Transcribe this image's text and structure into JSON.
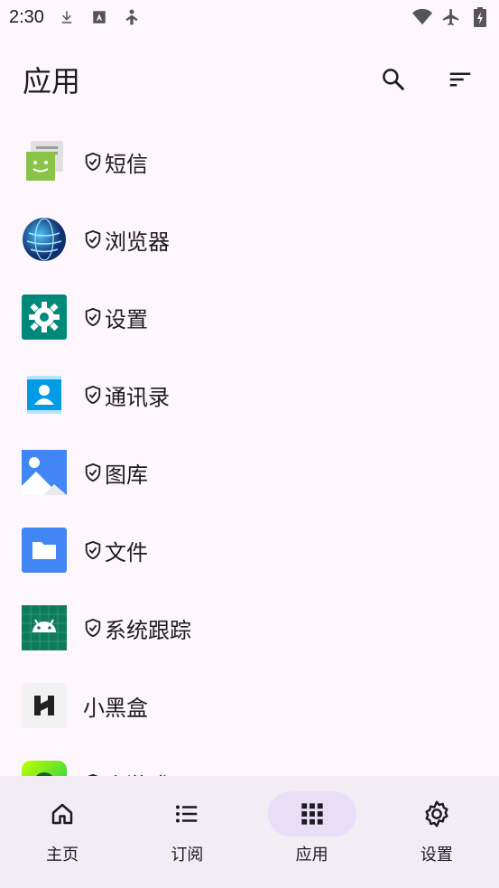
{
  "status_bar": {
    "time": "2:30",
    "left_icons": [
      "download-icon",
      "font-a-icon",
      "accessibility-icon"
    ],
    "right_icons": [
      "wifi-icon",
      "airplane-icon",
      "battery-charging-icon"
    ]
  },
  "header": {
    "title": "应用",
    "actions": [
      "search-icon",
      "sort-icon"
    ]
  },
  "apps": [
    {
      "label": "短信",
      "protected": true,
      "icon": "messages-icon"
    },
    {
      "label": "浏览器",
      "protected": true,
      "icon": "browser-icon"
    },
    {
      "label": "设置",
      "protected": true,
      "icon": "settings-app-icon"
    },
    {
      "label": "通讯录",
      "protected": true,
      "icon": "contacts-icon"
    },
    {
      "label": "图库",
      "protected": true,
      "icon": "gallery-icon"
    },
    {
      "label": "文件",
      "protected": true,
      "icon": "files-icon"
    },
    {
      "label": "系统跟踪",
      "protected": true,
      "icon": "system-tracing-icon"
    },
    {
      "label": "小黑盒",
      "protected": false,
      "icon": "xiaoheihe-icon"
    },
    {
      "label": "小游戏",
      "protected": true,
      "icon": "games-icon"
    }
  ],
  "bottom_nav": {
    "items": [
      {
        "label": "主页",
        "icon": "home-icon",
        "active": false
      },
      {
        "label": "订阅",
        "icon": "list-icon",
        "active": false
      },
      {
        "label": "应用",
        "icon": "apps-grid-icon",
        "active": true
      },
      {
        "label": "设置",
        "icon": "gear-icon",
        "active": false
      }
    ]
  },
  "colors": {
    "background": "#fdf7fd",
    "nav_background": "#f2ecf4",
    "active_pill": "#e8def8",
    "text": "#1c1b1f"
  }
}
